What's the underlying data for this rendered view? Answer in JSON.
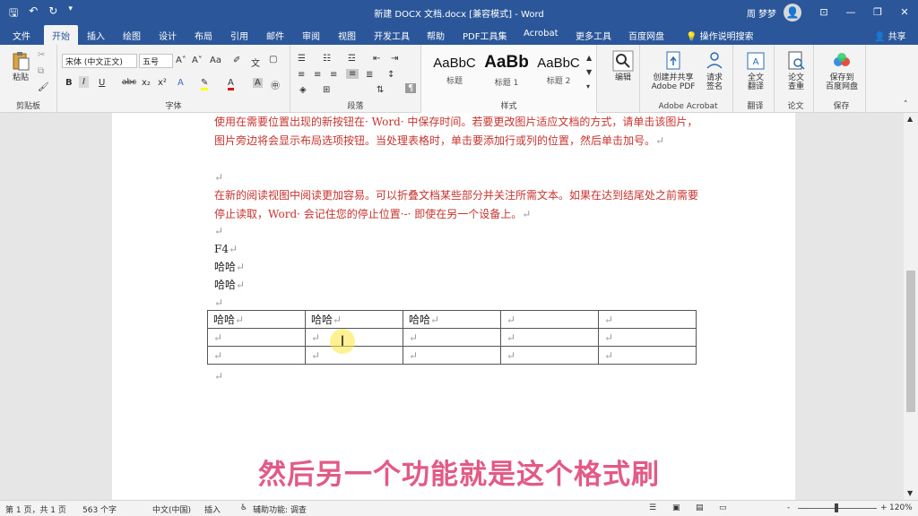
{
  "titlebar": {
    "title": "新建 DOCX 文档.docx [兼容模式] - Word",
    "user": "周 梦梦",
    "qat": [
      "save-icon",
      "undo-icon",
      "redo-icon",
      "customize-icon"
    ],
    "win": [
      "ribbon-display-icon",
      "minimize-icon",
      "restore-icon",
      "close-icon"
    ]
  },
  "tabs": [
    "文件",
    "开始",
    "插入",
    "绘图",
    "设计",
    "布局",
    "引用",
    "邮件",
    "审阅",
    "视图",
    "开发工具",
    "帮助",
    "PDF工具集",
    "Acrobat",
    "更多工具",
    "百度网盘"
  ],
  "active_tab": "开始",
  "tell_me": "操作说明搜索",
  "share": "共享",
  "ribbon": {
    "clipboard": {
      "label": "剪贴板",
      "paste": "粘贴"
    },
    "font": {
      "label": "字体",
      "font_name": "宋体 (中文正文)",
      "font_size": "五号",
      "grow": "A˄",
      "shrink": "A˅",
      "change_case": "Aa",
      "bold": "B",
      "italic": "I",
      "underline": "U",
      "strike": "abc",
      "sub": "x₂",
      "sup": "x²"
    },
    "paragraph": {
      "label": "段落"
    },
    "styles": {
      "label": "样式",
      "items": [
        {
          "preview": "AaBbC",
          "name": "标题"
        },
        {
          "preview": "AaBb",
          "name": "标题 1"
        },
        {
          "preview": "AaBbC",
          "name": "标题 2"
        }
      ]
    },
    "editing": {
      "label": "编辑"
    },
    "acrobat": {
      "label": "Adobe Acrobat",
      "create_share": "创建并共享",
      "create_share2": "Adobe PDF",
      "request": "请求",
      "request2": "签名"
    },
    "translate": {
      "label": "翻译",
      "btn1": "全文",
      "btn2": "翻译"
    },
    "paper": {
      "label": "论文",
      "btn1": "论文",
      "btn2": "查重"
    },
    "save": {
      "label": "保存",
      "btn1": "保存到",
      "btn2": "百度网盘"
    }
  },
  "document": {
    "p1": "使用在需要位置出现的新按钮在· Word· 中保存时间。若要更改图片适应文档的方式，请单击该图片，图片旁边将会显示布局选项按钮。当处理表格时，单击要添加行或列的位置，然后单击加号。",
    "p2": "在新的阅读视图中阅读更加容易。可以折叠文档某些部分并关注所需文本。如果在达到结尾处之前需要停止读取，Word· 会记住您的停止位置·-· 即使在另一个设备上。",
    "pilcrow": "↵",
    "l1": "F4",
    "l2": "哈哈",
    "l3": "哈哈",
    "table": [
      [
        "哈哈",
        "哈哈",
        "哈哈",
        "",
        ""
      ],
      [
        "",
        "",
        "",
        "",
        ""
      ],
      [
        "",
        "",
        "",
        "",
        ""
      ]
    ]
  },
  "caption": "然后另一个功能就是这个格式刷",
  "status": {
    "page": "第 1 页，共 1 页",
    "words": "563 个字",
    "lang": "中文(中国)",
    "mode": "插入",
    "access": "辅助功能: 调查",
    "zoom": "120%",
    "minus": "-",
    "plus": "+"
  }
}
